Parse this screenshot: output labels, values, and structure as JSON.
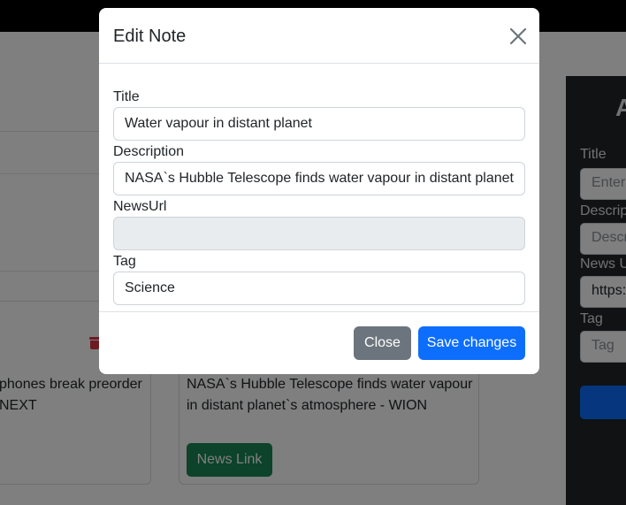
{
  "modal": {
    "title": "Edit Note",
    "fields": {
      "title": {
        "label": "Title",
        "value": "Water vapour in distant planet"
      },
      "description": {
        "label": "Description",
        "value": "NASA`s Hubble Telescope finds water vapour in distant planet`"
      },
      "news_url": {
        "label": "NewsUrl",
        "value": ""
      },
      "tag": {
        "label": "Tag",
        "value": "Science"
      }
    },
    "buttons": {
      "close": "Close",
      "save": "Save changes"
    }
  },
  "background": {
    "cards": [
      {
        "text_line1": "phones break preorder",
        "text_line2": "NEXT"
      },
      {
        "text_line1": "NASA`s Hubble Telescope finds water vapour",
        "text_line2": "in distant planet`s atmosphere - WION",
        "link_label": "News Link"
      }
    ],
    "side_form": {
      "heading": "A",
      "title_label": "Title",
      "title_placeholder": "Enter",
      "description_label": "Descrip",
      "description_placeholder": "Descr",
      "news_url_label": "News U",
      "news_url_value": "https:",
      "tag_label": "Tag",
      "tag_placeholder": "Tag"
    }
  },
  "colors": {
    "primary": "#0d6efd",
    "secondary": "#6c757d",
    "success": "#198754",
    "danger": "#dc3545",
    "dark": "#212529"
  }
}
